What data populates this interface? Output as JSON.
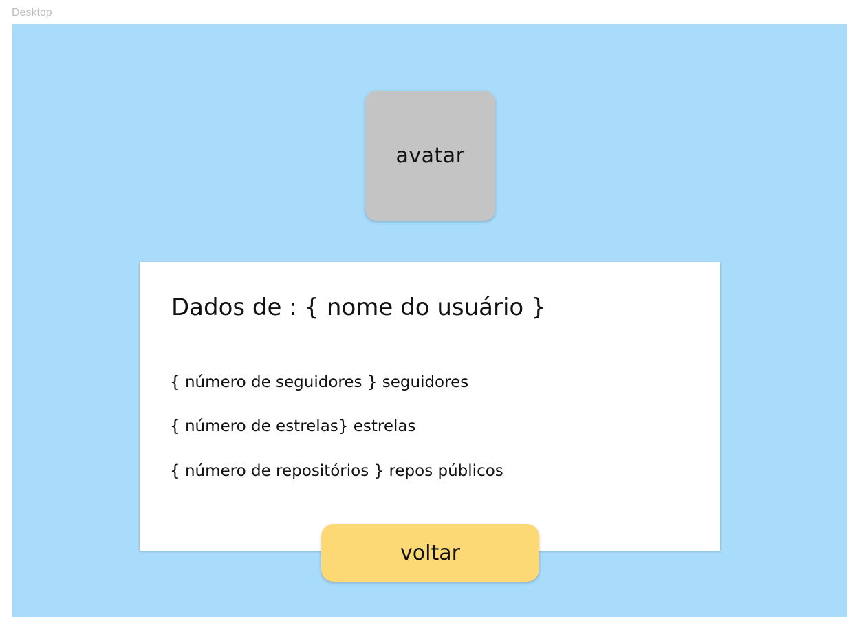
{
  "frame": {
    "label": "Desktop",
    "background_color": "#a8dcfa"
  },
  "avatar": {
    "label": "avatar",
    "color": "#c4c4c4"
  },
  "card": {
    "title": "Dados de : { nome do usuário }",
    "stats": [
      "{ número de seguidores } seguidores",
      "{ número de estrelas} estrelas",
      "{ número de repositórios } repos públicos"
    ]
  },
  "back_button": {
    "label": "voltar",
    "color": "#fcd975"
  }
}
